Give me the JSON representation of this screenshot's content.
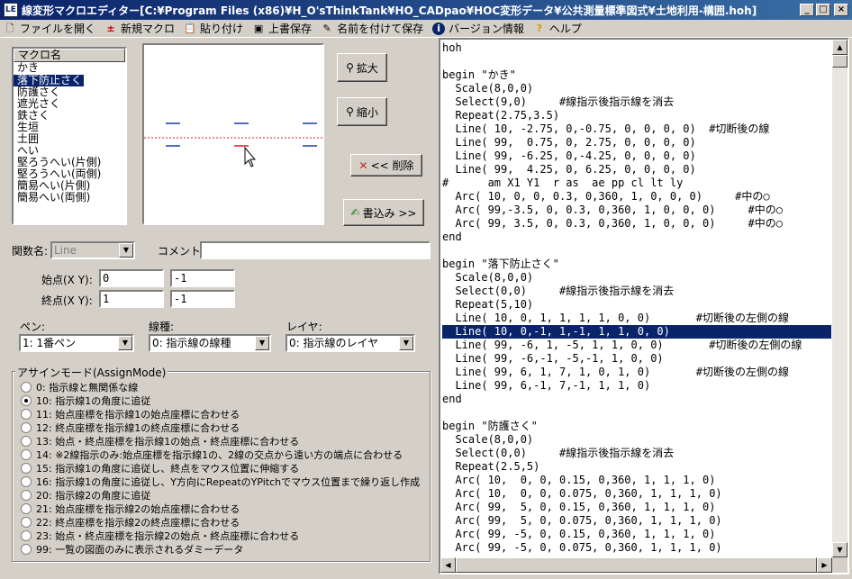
{
  "window": {
    "title": "線変形マクロエディター[C:¥Program Files (x86)¥H_O'sThinkTank¥HO_CADpao¥HOC変形データ¥公共測量標準図式¥土地利用-構囲.hoh]",
    "app_icon": "LE",
    "min_glyph": "_",
    "max_glyph": "□",
    "close_glyph": "×"
  },
  "menu": [
    {
      "icon": "open-folder-icon",
      "glyph": "🗋",
      "label": "ファイルを開く"
    },
    {
      "icon": "new-macro-icon",
      "glyph": "±",
      "label": "新規マクロ"
    },
    {
      "icon": "paste-icon",
      "glyph": "📋",
      "label": "貼り付け"
    },
    {
      "icon": "save-icon",
      "glyph": "▣",
      "label": "上書保存"
    },
    {
      "icon": "save-as-icon",
      "glyph": "✎",
      "label": "名前を付けて保存"
    },
    {
      "icon": "info-icon",
      "glyph": "i",
      "label": "バージョン情報"
    },
    {
      "icon": "help-icon",
      "glyph": "?",
      "label": "ヘルプ"
    }
  ],
  "macro_list": {
    "header": "マクロ名",
    "items": [
      "かき",
      "落下防止さく",
      "防護さく",
      "遮光さく",
      "鉄さく",
      "生垣",
      "土囲",
      "へい",
      "堅ろうへい(片側)",
      "堅ろうへい(両側)",
      "簡易へい(片側)",
      "簡易へい(両側)"
    ],
    "selected_index": 1
  },
  "buttons": {
    "zoom_in": "拡大",
    "zoom_out": "縮小",
    "delete": "<< 削除",
    "write": "書込み >>"
  },
  "form": {
    "function_label": "関数名:",
    "function_value": "Line",
    "comment_label": "コメント:",
    "comment_value": "",
    "start_label": "始点(X Y):",
    "start_x": "0",
    "start_y": "-1",
    "end_label": "終点(X Y):",
    "end_x": "1",
    "end_y": "-1",
    "pen_label": "ペン:",
    "pen_value": "1: 1番ペン",
    "linetype_label": "線種:",
    "linetype_value": "0: 指示線の線種",
    "layer_label": "レイヤ:",
    "layer_value": "0: 指示線のレイヤ"
  },
  "assign_mode": {
    "title": "アサインモード(AssignMode)",
    "selected_index": 1,
    "options": [
      "0: 指示線と無関係な線",
      "10: 指示線1の角度に追従",
      "11: 始点座標を指示線1の始点座標に合わせる",
      "12: 終点座標を指示線1の終点座標に合わせる",
      "13: 始点・終点座標を指示線1の始点・終点座標に合わせる",
      "14: ※2線指示のみ:始点座標を指示線1の、2線の交点から遠い方の端点に合わせる",
      "15: 指示線1の角度に追従し、終点をマウス位置に伸縮する",
      "16: 指示線1の角度に追従し、Y方向にRepeatのYPitchでマウス位置まで繰り返し作成",
      "20: 指示線2の角度に追従",
      "21: 始点座標を指示線2の始点座標に合わせる",
      "22: 終点座標を指示線2の終点座標に合わせる",
      "23: 始点・終点座標を指示線2の始点・終点座標に合わせる",
      "99: 一覧の図面のみに表示されるダミーデータ"
    ]
  },
  "editor": {
    "highlight_index": 21,
    "lines": [
      "hoh",
      "",
      "begin \"かき\"",
      "  Scale(8,0,0)",
      "  Select(9,0)     #線指示後指示線を消去",
      "  Repeat(2.75,3.5)",
      "  Line( 10, -2.75, 0,-0.75, 0, 0, 0, 0)  #切断後の線",
      "  Line( 99,  0.75, 0, 2.75, 0, 0, 0, 0)",
      "  Line( 99, -6.25, 0,-4.25, 0, 0, 0, 0)",
      "  Line( 99,  4.25, 0, 6.25, 0, 0, 0, 0)",
      "#      am X1 Y1  r as  ae pp cl lt ly",
      "  Arc( 10, 0, 0, 0.3, 0,360, 1, 0, 0, 0)     #中の○",
      "  Arc( 99,-3.5, 0, 0.3, 0,360, 1, 0, 0, 0)     #中の○",
      "  Arc( 99, 3.5, 0, 0.3, 0,360, 1, 0, 0, 0)     #中の○",
      "end",
      "",
      "begin \"落下防止さく\"",
      "  Scale(8,0,0)",
      "  Select(0,0)     #線指示後指示線を消去",
      "  Repeat(5,10)",
      "  Line( 10, 0, 1, 1, 1, 1, 0, 0)       #切断後の左側の線",
      "  Line( 10, 0,-1, 1,-1, 1, 1, 0, 0)",
      "  Line( 99, -6, 1, -5, 1, 1, 0, 0)       #切断後の左側の線",
      "  Line( 99, -6,-1, -5,-1, 1, 0, 0)",
      "  Line( 99, 6, 1, 7, 1, 0, 1, 0)       #切断後の左側の線",
      "  Line( 99, 6,-1, 7,-1, 1, 1, 0)",
      "end",
      "",
      "begin \"防護さく\"",
      "  Scale(8,0,0)",
      "  Select(0,0)     #線指示後指示線を消去",
      "  Repeat(2.5,5)",
      "  Arc( 10,  0, 0, 0.15, 0,360, 1, 1, 1, 0)",
      "  Arc( 10,  0, 0, 0.075, 0,360, 1, 1, 1, 0)",
      "  Arc( 99,  5, 0, 0.15, 0,360, 1, 1, 1, 0)",
      "  Arc( 99,  5, 0, 0.075, 0,360, 1, 1, 1, 0)",
      "  Arc( 99, -5, 0, 0.15, 0,360, 1, 1, 1, 0)",
      "  Arc( 99, -5, 0, 0.075, 0,360, 1, 1, 1, 0)"
    ]
  },
  "colors": {
    "selection": "#0a246a",
    "preview_blue": "#1a3aa8",
    "preview_red": "#d02020"
  }
}
